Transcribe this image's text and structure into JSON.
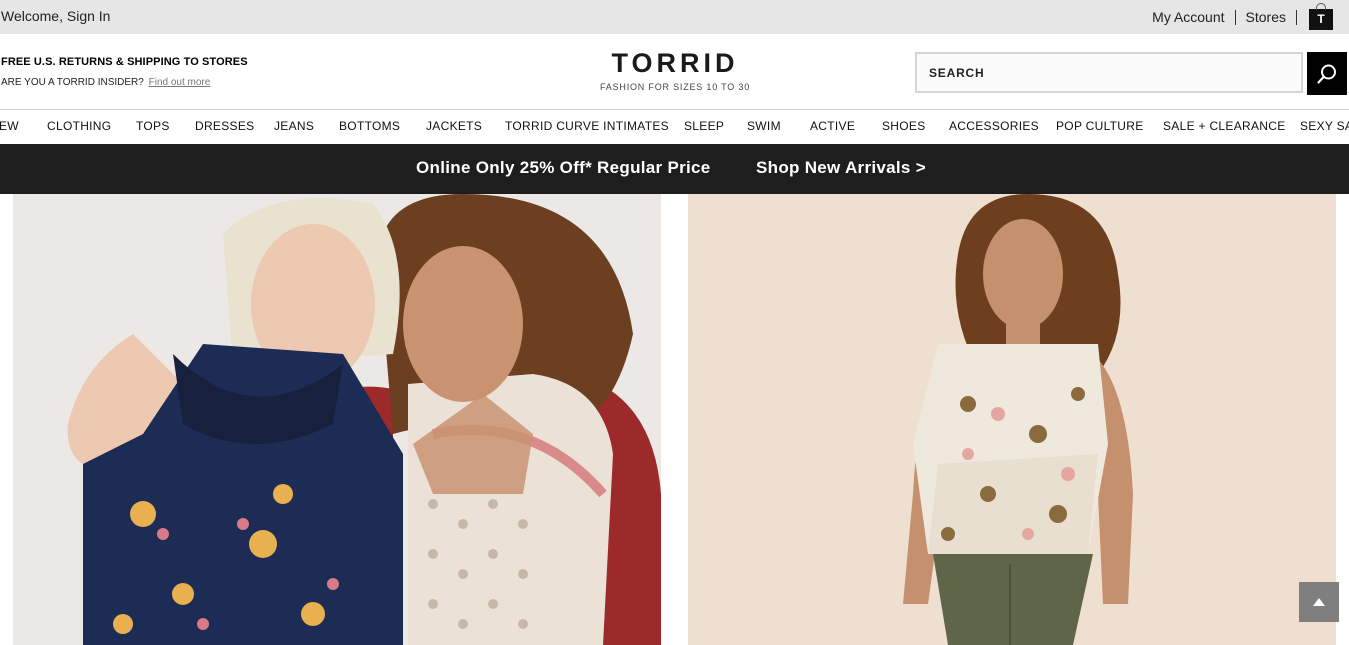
{
  "utility_bar": {
    "welcome": "Welcome, Sign In",
    "my_account": "My Account",
    "stores": "Stores",
    "bag_letter": "T"
  },
  "header": {
    "promo_line1": "FREE U.S. RETURNS & SHIPPING TO STORES",
    "promo_line2": "ARE YOU A TORRID INSIDER?",
    "promo_link": "Find out more",
    "logo": "TORRID",
    "tagline": "FASHION FOR SIZES 10 TO 30",
    "search_placeholder": "SEARCH",
    "search_icon": "magnifier-icon"
  },
  "nav": {
    "items": [
      "EW",
      "CLOTHING",
      "TOPS",
      "DRESSES",
      "JEANS",
      "BOTTOMS",
      "JACKETS",
      "TORRID CURVE INTIMATES",
      "SLEEP",
      "SWIM",
      "ACTIVE",
      "SHOES",
      "ACCESSORIES",
      "POP CULTURE",
      "SALE + CLEARANCE",
      "SEXY SA"
    ]
  },
  "banner": {
    "offer": "Online Only 25% Off* Regular Price",
    "cta": "Shop New Arrivals >"
  },
  "colors": {
    "banner_bg": "#1e1e1e",
    "utility_bg": "#e6e6e6",
    "navy_top": "#1d2c55",
    "cardigan": "#9c2a2a",
    "olive_pants": "#5e6548"
  }
}
